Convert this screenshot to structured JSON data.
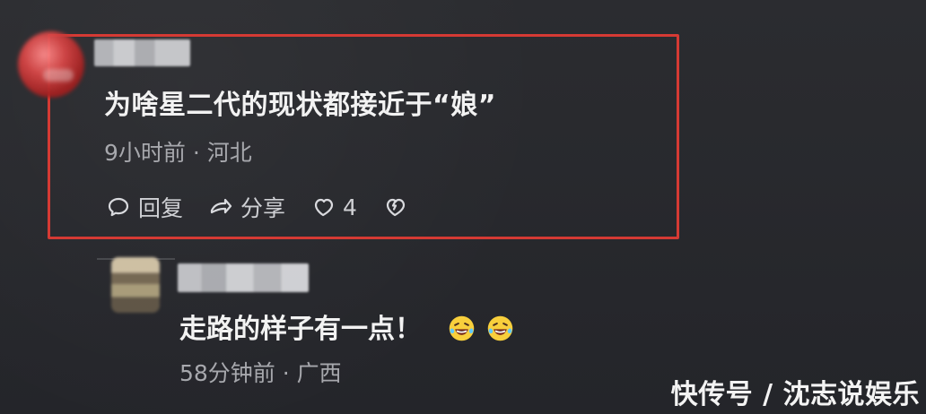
{
  "main_comment": {
    "text": "为啥星二代的现状都接近于“娘”",
    "time": "9小时前",
    "separator": "·",
    "location": "河北",
    "actions": {
      "reply_label": "回复",
      "share_label": "分享",
      "like_count": "4"
    }
  },
  "reply_comment": {
    "text": "走路的样子有一点！",
    "time": "58分钟前",
    "separator": "·",
    "location": "广西"
  },
  "watermark": "快传号 / 沈志说娱乐",
  "colors": {
    "background": "#27282c",
    "highlight": "#d53a34",
    "text_primary": "#f2f2f2",
    "text_secondary": "#a7a8ad"
  },
  "icons": {
    "reply": "comment-bubble-icon",
    "share": "share-arrow-icon",
    "like": "heart-icon",
    "dislike": "broken-heart-icon",
    "emoji": "laughing-with-tears-emoji"
  }
}
